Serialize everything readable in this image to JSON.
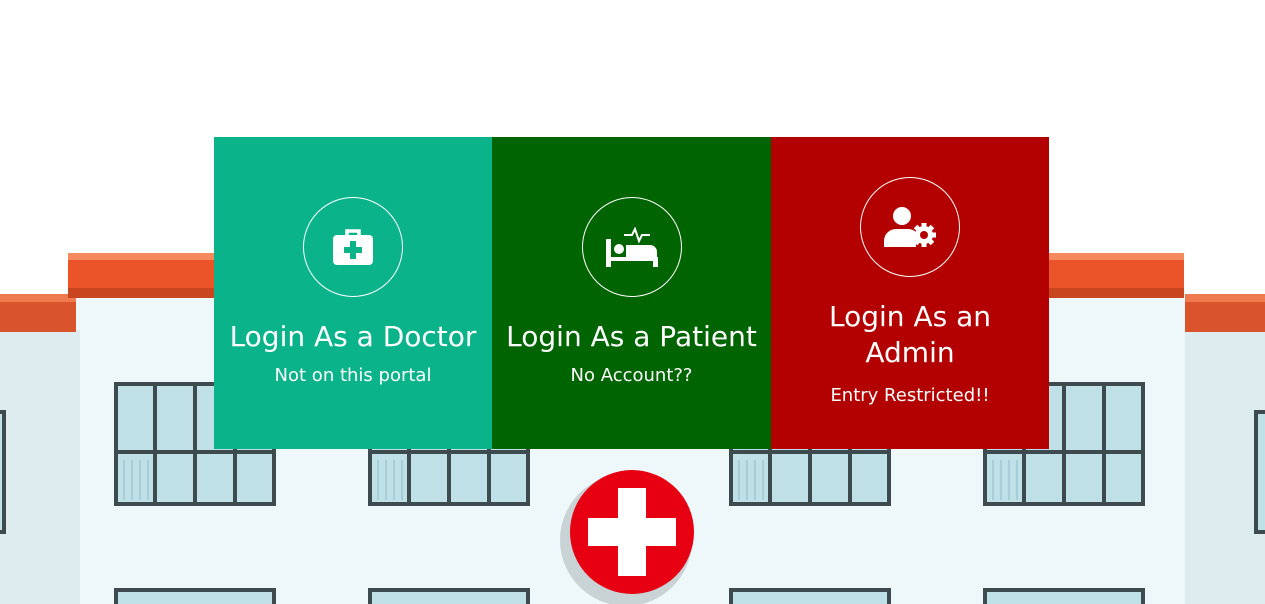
{
  "login_cards": [
    {
      "id": "doctor",
      "title": "Login As a Doctor",
      "subtitle": "Not on this portal",
      "icon": "medical-kit-icon",
      "color": "#0bb38b"
    },
    {
      "id": "patient",
      "title": "Login As a Patient",
      "subtitle": "No Account??",
      "icon": "hospital-bed-icon",
      "color": "#006400"
    },
    {
      "id": "admin",
      "title": "Login As an Admin",
      "subtitle": "Entry Restricted!!",
      "icon": "user-gear-icon",
      "color": "#b30000"
    }
  ],
  "background": {
    "illustration": "hospital-building",
    "roof_color": "#e8542a",
    "wall_color": "#dff0f3",
    "cross_color": "#e60012"
  }
}
